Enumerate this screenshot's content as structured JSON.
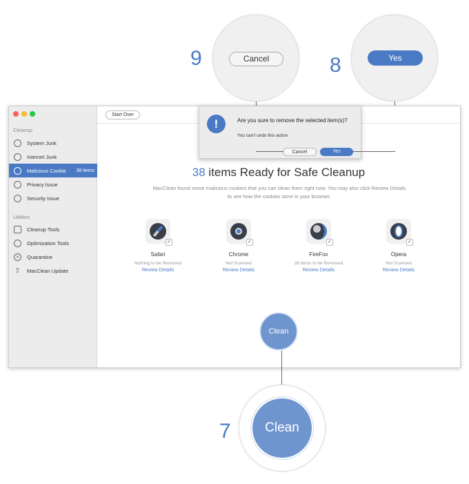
{
  "window": {
    "start_over": "Start Over"
  },
  "sidebar": {
    "cleanup_label": "Cleanup",
    "items": [
      {
        "label": "System Junk",
        "icon": "trash-icon"
      },
      {
        "label": "Internet Junk",
        "icon": "compass-icon"
      },
      {
        "label": "Malicious Cookie",
        "icon": "cookie-icon",
        "badge": "38 items",
        "active": true
      },
      {
        "label": "Privacy Issue",
        "icon": "eye-icon"
      },
      {
        "label": "Security Issue",
        "icon": "shield-icon"
      }
    ],
    "utilities_label": "Utilities",
    "utilities": [
      {
        "label": "Cleanup Tools",
        "icon": "toolbox-icon"
      },
      {
        "label": "Optimization Tools",
        "icon": "gauge-icon"
      },
      {
        "label": "Quarantine",
        "icon": "quarantine-icon"
      },
      {
        "label": "MacClean Update",
        "icon": "arrow-up-icon"
      }
    ]
  },
  "main": {
    "count": "38",
    "title_rest": " items Ready for Safe Cleanup",
    "description": "MacClean found some malicious cookies that you can clean them right now. You may also click Review Details to see how the cookies store in your browser.",
    "browsers": [
      {
        "name": "Safari",
        "status": "Nothing to be Removed",
        "link": "Review Details"
      },
      {
        "name": "Chrome",
        "status": "Not Scanned",
        "link": "Review Details"
      },
      {
        "name": "FireFox",
        "status": "38 items to be Removed",
        "link": "Review Details"
      },
      {
        "name": "Opera",
        "status": "Not Scanned",
        "link": "Review Details"
      }
    ],
    "clean": "Clean"
  },
  "dialog": {
    "title": "Are you sure to remove the selected item(s)?",
    "subtitle": "You can't undo this action",
    "cancel": "Cancel",
    "yes": "Yes"
  },
  "callouts": {
    "cancel_step": "9",
    "yes_step": "8",
    "clean_step": "7",
    "cancel": "Cancel",
    "yes": "Yes",
    "clean": "Clean"
  },
  "colors": {
    "accent": "#4a7ac4",
    "clean_button": "#6f95cf"
  }
}
